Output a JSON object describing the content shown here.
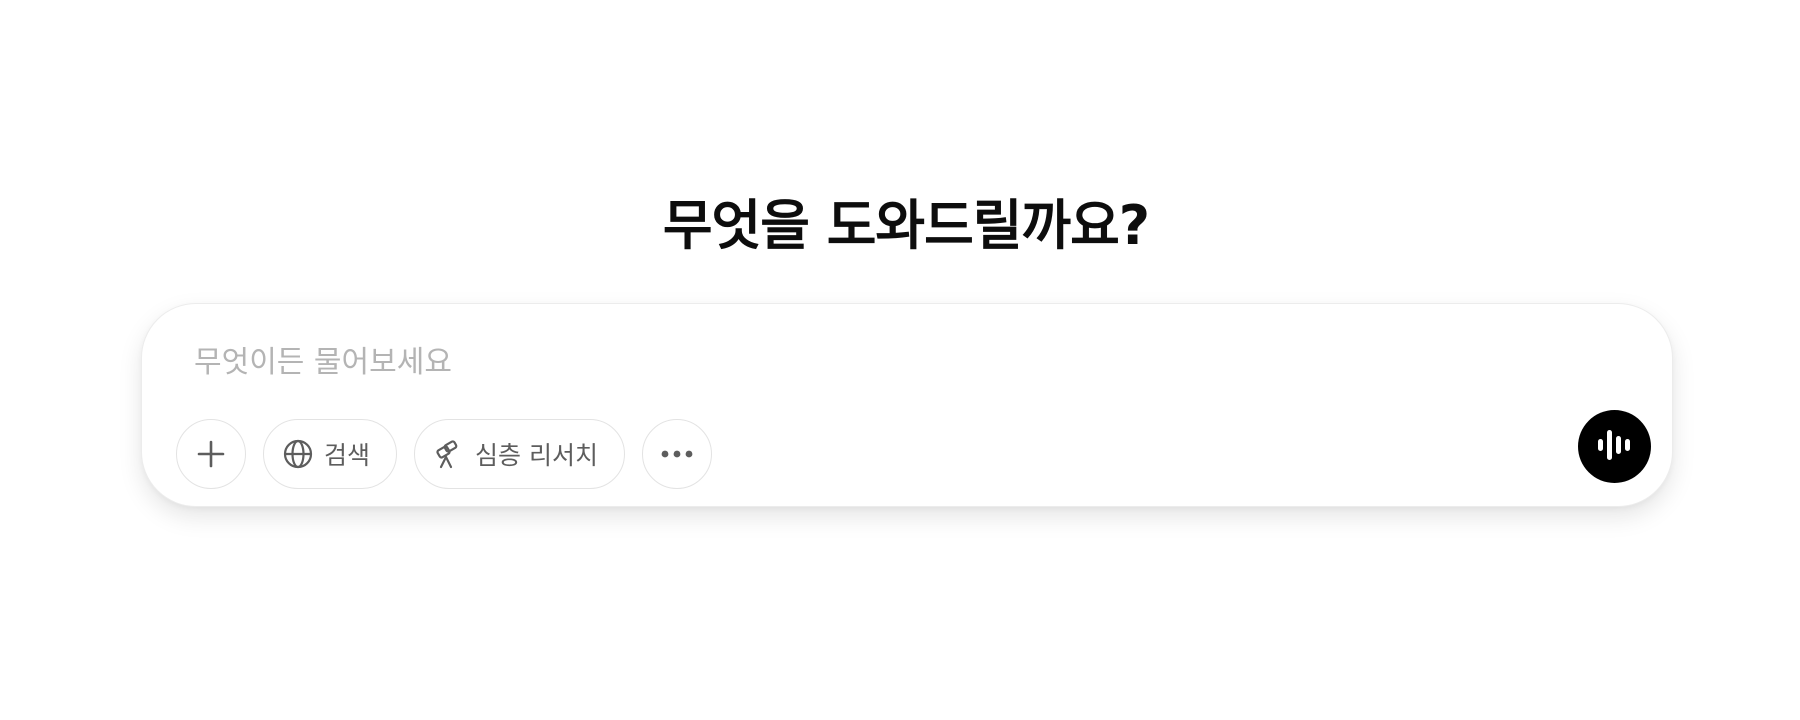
{
  "heading": "무엇을 도와드릴까요?",
  "composer": {
    "placeholder": "무엇이든 물어보세요",
    "value": ""
  },
  "toolbar": {
    "add_icon": "plus-icon",
    "search": {
      "label": "검색",
      "icon": "globe-icon"
    },
    "deep_research": {
      "label": "심층 리서치",
      "icon": "telescope-icon"
    },
    "more_icon": "ellipsis-icon"
  },
  "voice_button": {
    "icon": "voice-waveform-icon"
  },
  "colors": {
    "background": "#ffffff",
    "heading_text": "#0d0d0d",
    "placeholder_text": "#b4b4b4",
    "pill_border": "#e3e3e3",
    "pill_text": "#5d5d5d",
    "voice_button_bg": "#000000"
  }
}
